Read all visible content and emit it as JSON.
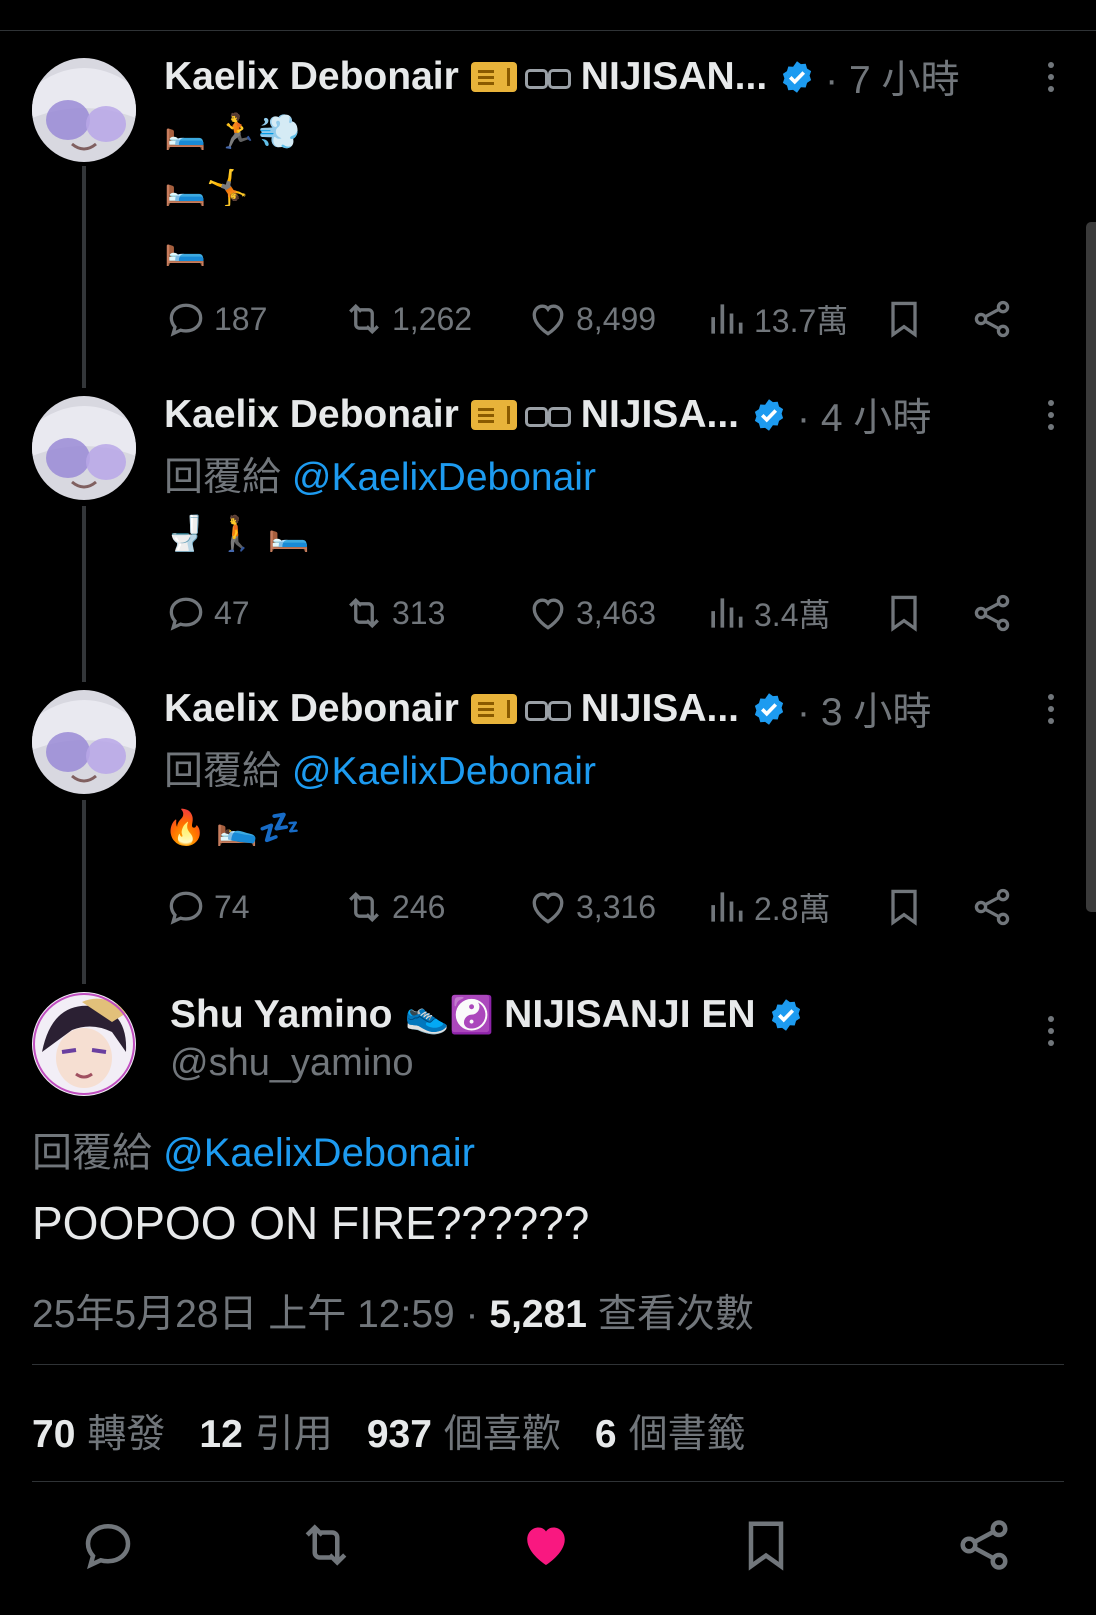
{
  "thread": [
    {
      "name": "Kaelix Debonair",
      "org": "NIJISAN...",
      "time": "· 7 小時",
      "reply_prefix": "",
      "reply_mention": "",
      "lines": [
        "🛏️          🏃💨",
        "🛏️🤸",
        "🛏️"
      ],
      "reply_count": "187",
      "retweet_count": "1,262",
      "like_count": "8,499",
      "view_count": "13.7萬"
    },
    {
      "name": "Kaelix Debonair",
      "org": "NIJISA...",
      "time": "· 4 小時",
      "reply_prefix": "回覆給",
      "reply_mention": "@KaelixDebonair",
      "lines": [
        "🚽     🚶                 🛏️"
      ],
      "reply_count": "47",
      "retweet_count": "313",
      "like_count": "3,463",
      "view_count": "3.4萬"
    },
    {
      "name": "Kaelix Debonair",
      "org": "NIJISA...",
      "time": "· 3 小時",
      "reply_prefix": "回覆給",
      "reply_mention": "@KaelixDebonair",
      "lines": [
        "🔥                          🛌💤"
      ],
      "reply_count": "74",
      "retweet_count": "246",
      "like_count": "3,316",
      "view_count": "2.8萬"
    }
  ],
  "main": {
    "name": "Shu Yamino",
    "emoji": "👟☯️",
    "org": "NIJISANJI EN",
    "handle": "@shu_yamino",
    "reply_prefix": "回覆給",
    "reply_mention": "@KaelixDebonair",
    "text": "POOPOO ON FIRE??????",
    "datetime": "25年5月28日 上午 12:59 · ",
    "views_number": "5,281",
    "views_label": " 查看次數",
    "stats": {
      "retweets_num": "70",
      "retweets_label": "轉發",
      "quotes_num": "12",
      "quotes_label": "引用",
      "likes_num": "937",
      "likes_label": "個喜歡",
      "bookmarks_num": "6",
      "bookmarks_label": "個書籤"
    }
  },
  "colors": {
    "background": "#000000",
    "accent": "#1d9bf0",
    "like_active": "#f91880",
    "muted": "#71767b"
  },
  "icons": [
    "reply-icon",
    "retweet-icon",
    "like-icon",
    "views-icon",
    "bookmark-icon",
    "share-icon",
    "verified-icon",
    "more-icon"
  ]
}
